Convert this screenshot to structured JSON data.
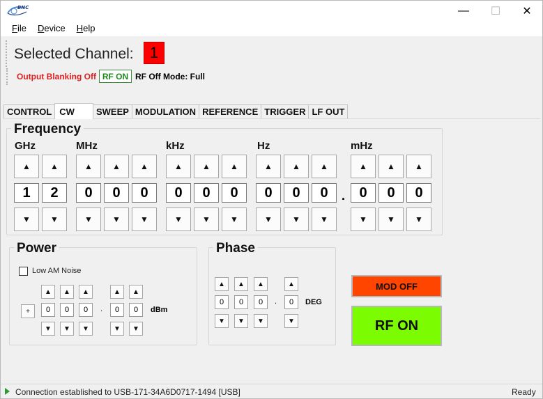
{
  "window": {
    "logo_text": "BNC",
    "minimize_glyph": "—",
    "maximize_glyph": "☐",
    "close_glyph": "✕"
  },
  "menu": {
    "items": [
      "File",
      "Device",
      "Help"
    ]
  },
  "channel": {
    "label": "Selected Channel:",
    "number": "1",
    "number_color": "#ff0000"
  },
  "status_strip": {
    "blanking": "Output Blanking Off",
    "rf_state": "RF ON",
    "rf_off_mode": "RF Off Mode: Full"
  },
  "tabs": [
    "CONTROL",
    "CW",
    "SWEEP",
    "MODULATION",
    "REFERENCE",
    "TRIGGER",
    "LF OUT"
  ],
  "active_tab": "CW",
  "frequency": {
    "title": "Frequency",
    "units": [
      "GHz",
      "MHz",
      "kHz",
      "Hz",
      "mHz"
    ],
    "digits": {
      "ghz": [
        "1",
        "2"
      ],
      "mhz": [
        "0",
        "0",
        "0"
      ],
      "khz": [
        "0",
        "0",
        "0"
      ],
      "hz": [
        "0",
        "0",
        "0"
      ],
      "mhz_milli": [
        "0",
        "0",
        "0"
      ]
    },
    "decimal_point": ".",
    "up_glyph": "▲",
    "down_glyph": "▼"
  },
  "power": {
    "title": "Power",
    "low_am_noise_label": "Low AM Noise",
    "low_am_noise_checked": false,
    "sign": "+",
    "integer_digits": [
      "0",
      "0",
      "0"
    ],
    "decimal_digits": [
      "0",
      "0"
    ],
    "decimal_point": ".",
    "unit": "dBm"
  },
  "phase": {
    "title": "Phase",
    "integer_digits": [
      "0",
      "0",
      "0"
    ],
    "decimal_digits": [
      "0"
    ],
    "decimal_point": ".",
    "unit": "DEG"
  },
  "buttons": {
    "mod_off": "MOD OFF",
    "mod_off_color": "#ff4500",
    "rf_on": "RF ON",
    "rf_on_color": "#7cfc00"
  },
  "statusbar": {
    "message": "Connection established to USB-171-34A6D0717-1494 [USB]",
    "state": "Ready"
  }
}
